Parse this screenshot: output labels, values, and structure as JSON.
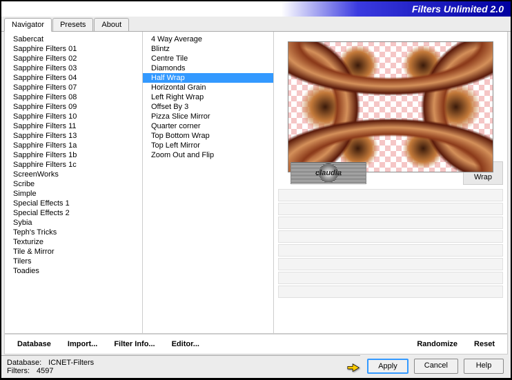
{
  "title": "Filters Unlimited 2.0",
  "tabs": [
    "Navigator",
    "Presets",
    "About"
  ],
  "leftList": [
    "Sabercat",
    "Sapphire Filters 01",
    "Sapphire Filters 02",
    "Sapphire Filters 03",
    "Sapphire Filters 04",
    "Sapphire Filters 07",
    "Sapphire Filters 08",
    "Sapphire Filters 09",
    "Sapphire Filters 10",
    "Sapphire Filters 11",
    "Sapphire Filters 13",
    "Sapphire Filters 1a",
    "Sapphire Filters 1b",
    "Sapphire Filters 1c",
    "ScreenWorks",
    "Scribe",
    "Simple",
    "Special Effects 1",
    "Special Effects 2",
    "Sybia",
    "Teph's Tricks",
    "Texturize",
    "Tile & Mirror",
    "Tilers",
    "Toadies"
  ],
  "midList": [
    "4 Way Average",
    "Blintz",
    "Centre Tile",
    "Diamonds",
    "Half Wrap",
    "Horizontal Grain",
    "Left Right Wrap",
    "Offset By 3",
    "Pizza Slice Mirror",
    "Quarter corner",
    "Top Bottom Wrap",
    "Top Left Mirror",
    "Zoom Out and Flip"
  ],
  "leftSelected": "Simple",
  "midSelected": "Half Wrap",
  "filterName": "Half Wrap",
  "logoText": "claudia",
  "btns": {
    "database": "Database",
    "import": "Import...",
    "filterInfo": "Filter Info...",
    "editor": "Editor...",
    "randomize": "Randomize",
    "reset": "Reset",
    "apply": "Apply",
    "cancel": "Cancel",
    "help": "Help"
  },
  "status": {
    "dbLabel": "Database:",
    "dbVal": "ICNET-Filters",
    "fLabel": "Filters:",
    "fVal": "4597"
  }
}
